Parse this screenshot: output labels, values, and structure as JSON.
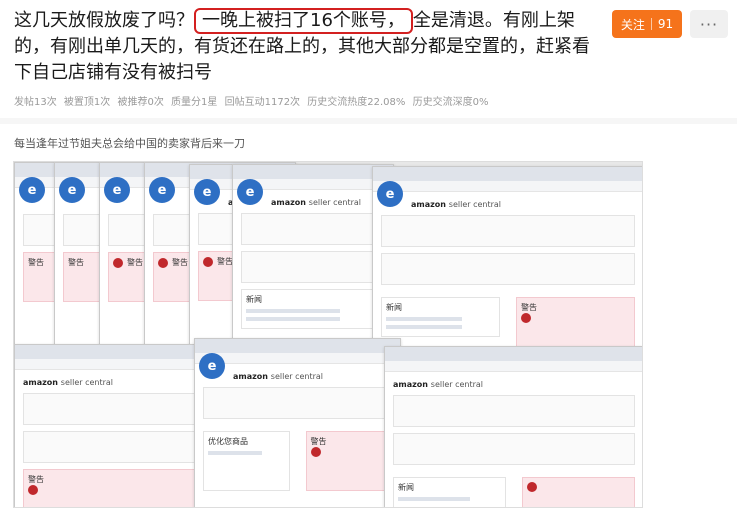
{
  "post": {
    "title_before": "这几天放假放废了吗？",
    "title_highlight": "一晚上被扫了16个账号，",
    "title_after": "全是清退。有刚上架的，有刚出单几天的，有货还在路上的，其他大部分都是空置的，赶紧看下自己店铺有没有被扫号"
  },
  "follow": {
    "label": "关注",
    "count": "91"
  },
  "more": {
    "label": "···"
  },
  "stats": [
    "发帖13次",
    "被置顶1次",
    "被推荐0次",
    "质量分1星",
    "回帖互动1172次",
    "历史交流热度22.08%",
    "历史交流深度0%"
  ],
  "caption": "每当逢年过节姐夫总会给中国的卖家背后来一刀",
  "screenshot": {
    "brand": "amazon",
    "brand_suffix": "seller central",
    "warning_label": "警告",
    "news_label": "新闻",
    "listing_label": "优化您商品",
    "logo_letter": "e"
  },
  "colors": {
    "accent": "#f5731b",
    "highlight_border": "#d32020",
    "warning_bg": "#fbe7ea"
  }
}
